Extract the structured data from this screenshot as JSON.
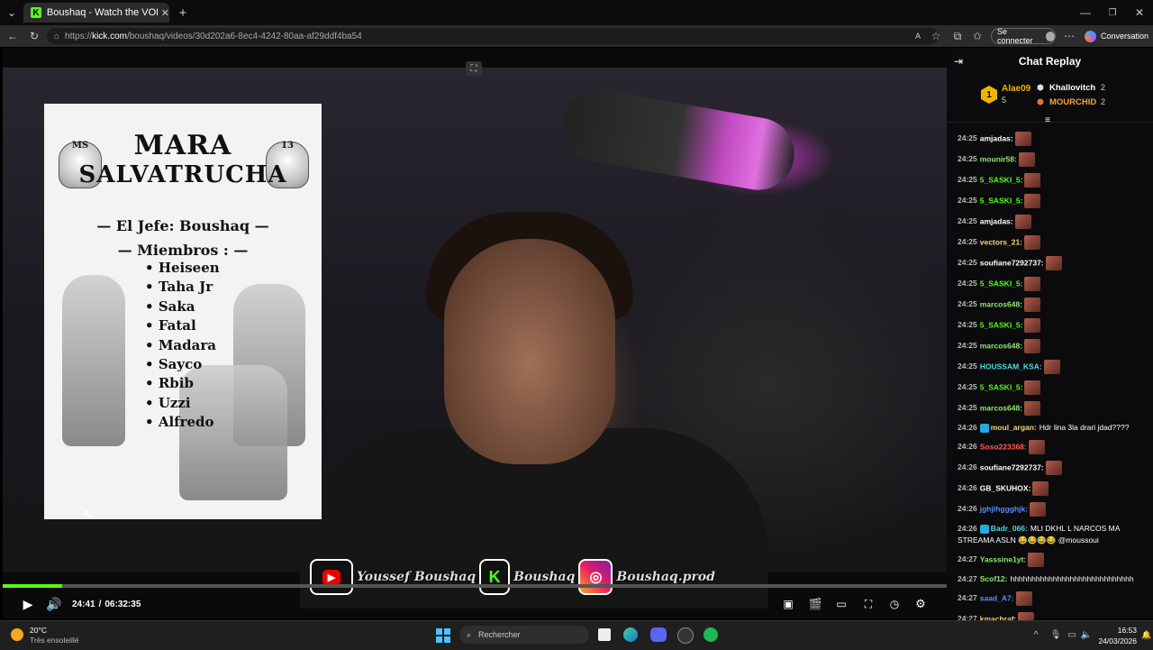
{
  "browser": {
    "tab_title": "Boushaq - Watch the VOD on Kick",
    "url_prefix": "https://",
    "url_domain": "kick.com",
    "url_path": "/boushaq/videos/30d202a6-8ec4-4242-80aa-af29ddf4ba54",
    "signin_label": "Se connecter",
    "copilot_label": "Conversation"
  },
  "poster": {
    "title_line1": "MARA",
    "title_line2": "SALVATRUCHA",
    "skull_left": "MS",
    "skull_right": "13",
    "jefe": "— El Jefe: Boushaq —",
    "members_heading": "— Miembros : —",
    "members": [
      "Heiseen",
      "Taha Jr",
      "Saka",
      "Fatal",
      "Madara",
      "Sayco",
      "Rbib",
      "Uzzi",
      "Alfredo"
    ]
  },
  "socials": {
    "youtube": "Youssef Boushaq",
    "kick": "Boushaq",
    "instagram": "Boushaq.prod"
  },
  "player": {
    "current_time": "24:41",
    "separator": "/",
    "duration": "06:32:35",
    "progress": 0.063
  },
  "chat": {
    "title": "Chat Replay",
    "leaderboard": {
      "first": {
        "rank": "1",
        "name": "Alae09",
        "count": "5"
      },
      "second": {
        "name": "Khallovitch",
        "count": "2"
      },
      "third": {
        "name": "MOURCHID",
        "count": "2"
      }
    },
    "messages": [
      {
        "time": "24:25",
        "user": "amjadas:",
        "color": "#ffffff",
        "text": "",
        "emote": true
      },
      {
        "time": "24:25",
        "user": "mounir58:",
        "color": "#8ee86f",
        "text": "",
        "emote": true
      },
      {
        "time": "24:25",
        "user": "5_SASKI_5:",
        "color": "#53fc18",
        "text": "",
        "emote": true
      },
      {
        "time": "24:25",
        "user": "5_SASKI_5:",
        "color": "#53fc18",
        "text": "",
        "emote": true
      },
      {
        "time": "24:25",
        "user": "amjadas:",
        "color": "#ffffff",
        "text": "",
        "emote": true
      },
      {
        "time": "24:25",
        "user": "vectors_21:",
        "color": "#f5d76e",
        "text": "",
        "emote": true
      },
      {
        "time": "24:25",
        "user": "soufiane7292737:",
        "color": "#ffffff",
        "text": "",
        "emote": true
      },
      {
        "time": "24:25",
        "user": "5_SASKI_5:",
        "color": "#53fc18",
        "text": "",
        "emote": true
      },
      {
        "time": "24:25",
        "user": "marcos648:",
        "color": "#8ee86f",
        "text": "",
        "emote": true
      },
      {
        "time": "24:25",
        "user": "5_SASKI_5:",
        "color": "#53fc18",
        "text": "",
        "emote": true
      },
      {
        "time": "24:25",
        "user": "marcos648:",
        "color": "#8ee86f",
        "text": "",
        "emote": true
      },
      {
        "time": "24:25",
        "user": "HOUSSAM_KSA:",
        "color": "#4fd8d8",
        "text": "",
        "emote": true
      },
      {
        "time": "24:25",
        "user": "5_SASKI_5:",
        "color": "#53fc18",
        "text": "",
        "emote": true
      },
      {
        "time": "24:25",
        "user": "marcos648:",
        "color": "#8ee86f",
        "text": "",
        "emote": true
      },
      {
        "time": "24:26",
        "user": "moul_argan:",
        "color": "#f5d76e",
        "text": "Hdr lina 3la drari jdad????",
        "emote": false,
        "badges": true
      },
      {
        "time": "24:26",
        "user": "Soso223368:",
        "color": "#ff5a5a",
        "text": "",
        "emote": true
      },
      {
        "time": "24:26",
        "user": "soufiane7292737:",
        "color": "#ffffff",
        "text": "",
        "emote": true
      },
      {
        "time": "24:26",
        "user": "GB_SKUHOX:",
        "color": "#ffffff",
        "text": "",
        "emote": true
      },
      {
        "time": "24:26",
        "user": "jghjlhggghjk:",
        "color": "#5a8cff",
        "text": "",
        "emote": true
      },
      {
        "time": "24:26",
        "user": "Badr_066:",
        "color": "#4fd8d8",
        "text": "MLI DKHL L NARCOS MA STREAMA ASLN 😂😂😂😂 @moussoui",
        "emote": false,
        "badges": true
      },
      {
        "time": "24:27",
        "user": "Yasssine1yt:",
        "color": "#8ee86f",
        "text": "",
        "emote": true
      },
      {
        "time": "24:27",
        "user": "Scof12:",
        "color": "#8ee86f",
        "text": "hhhhhhhhhhhhhhhhhhhhhhhhhhhhh",
        "emote": false
      },
      {
        "time": "24:27",
        "user": "saad_A7:",
        "color": "#5a8cff",
        "text": "",
        "emote": true
      },
      {
        "time": "24:27",
        "user": "kmachraf:",
        "color": "#f5d76e",
        "text": "",
        "emote": true
      }
    ]
  },
  "taskbar": {
    "temperature": "20°C",
    "weather": "Très ensoleillé",
    "search_placeholder": "Rechercher",
    "time": "16:53",
    "date": "24/03/2026"
  },
  "colors": {
    "kick_green": "#53fc18",
    "chat_bg": "#0b0b0d"
  }
}
